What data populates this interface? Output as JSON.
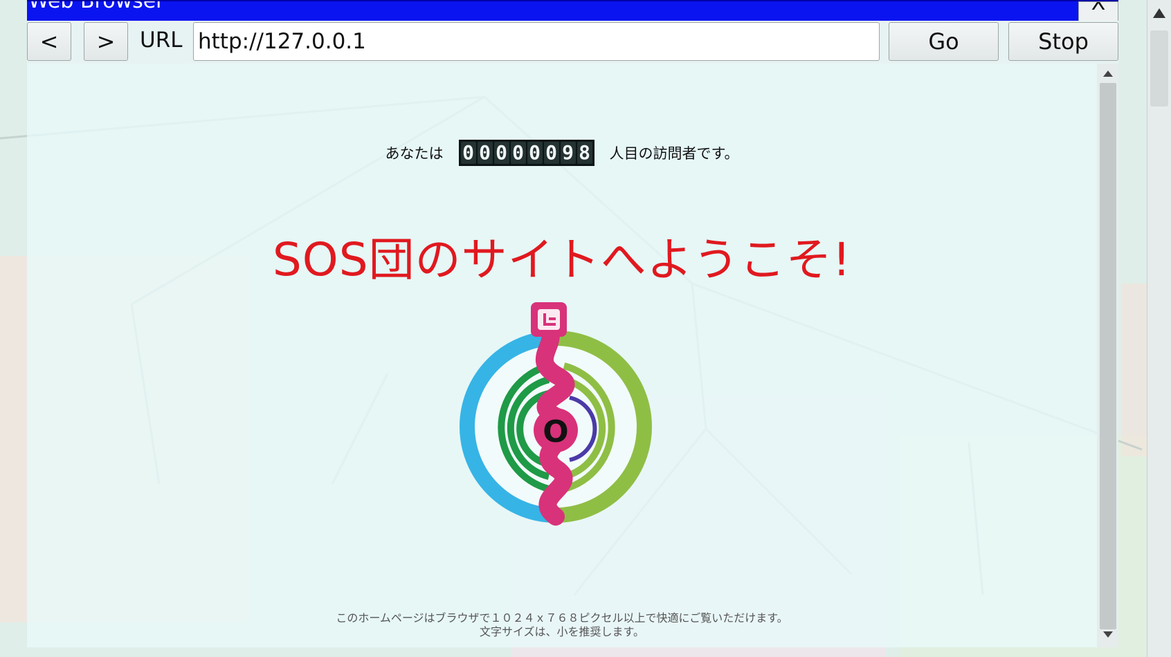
{
  "window": {
    "title": "Web Browser",
    "close_label": "X"
  },
  "toolbar": {
    "back_label": "<",
    "forward_label": ">",
    "url_label": "URL",
    "url_value": "http://127.0.0.1",
    "go_label": "Go",
    "stop_label": "Stop"
  },
  "page": {
    "counter_prefix": "あなたは",
    "counter_digits": [
      "0",
      "0",
      "0",
      "0",
      "0",
      "0",
      "9",
      "8"
    ],
    "counter_suffix": "人目の訪問者です。",
    "headline": "SOS団のサイトへようこそ!",
    "logo_text": "O",
    "footer_line1": "このホームページはブラウザで１０２４ｘ７６８ピクセル以上で快適にご覧いただけます。",
    "footer_line2": "文字サイズは、小を推奨します。"
  },
  "colors": {
    "titlebar": "#0a14f0",
    "headline": "#e0191f",
    "logo_pink": "#d8327a",
    "logo_blue": "#36b4e6",
    "logo_green": "#8fbe45",
    "logo_dark_green": "#1f9a47",
    "logo_purple": "#4a3aa8"
  }
}
